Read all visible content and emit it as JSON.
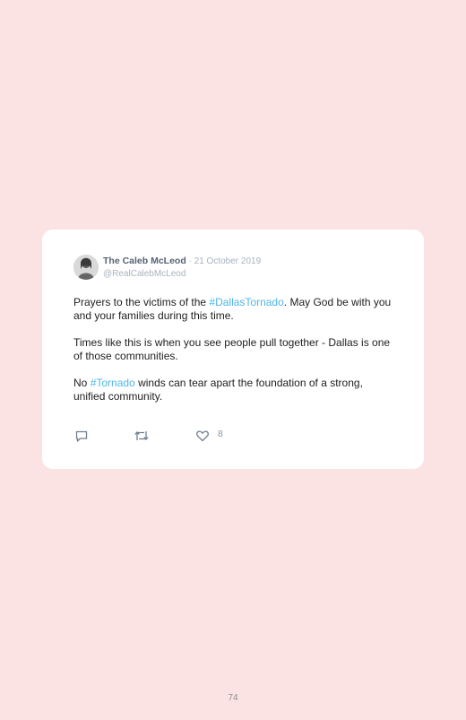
{
  "tweet": {
    "display_name": "The Caleb McLeod",
    "separator": " · ",
    "date": "21 October 2019",
    "handle": "@RealCalebMcLeod",
    "paragraph1": {
      "before": "Prayers to the victims of the ",
      "hashtag": "#DallasTornado",
      "after": ". May God be with you and your families during this time."
    },
    "paragraph2": "Times like this is when you see people pull together - Dallas is one of those communities.",
    "paragraph3": {
      "before": "No ",
      "hashtag": "#Tornado",
      "after": " winds can tear apart the foundation of a strong, unified community."
    },
    "like_count": "8",
    "icons": [
      "reply-icon",
      "retweet-icon",
      "heart-icon"
    ],
    "colors": {
      "hashtag": "#4fb6e6",
      "background": "#fbe3e4",
      "name": "#556275"
    }
  },
  "page": {
    "number": "74"
  }
}
